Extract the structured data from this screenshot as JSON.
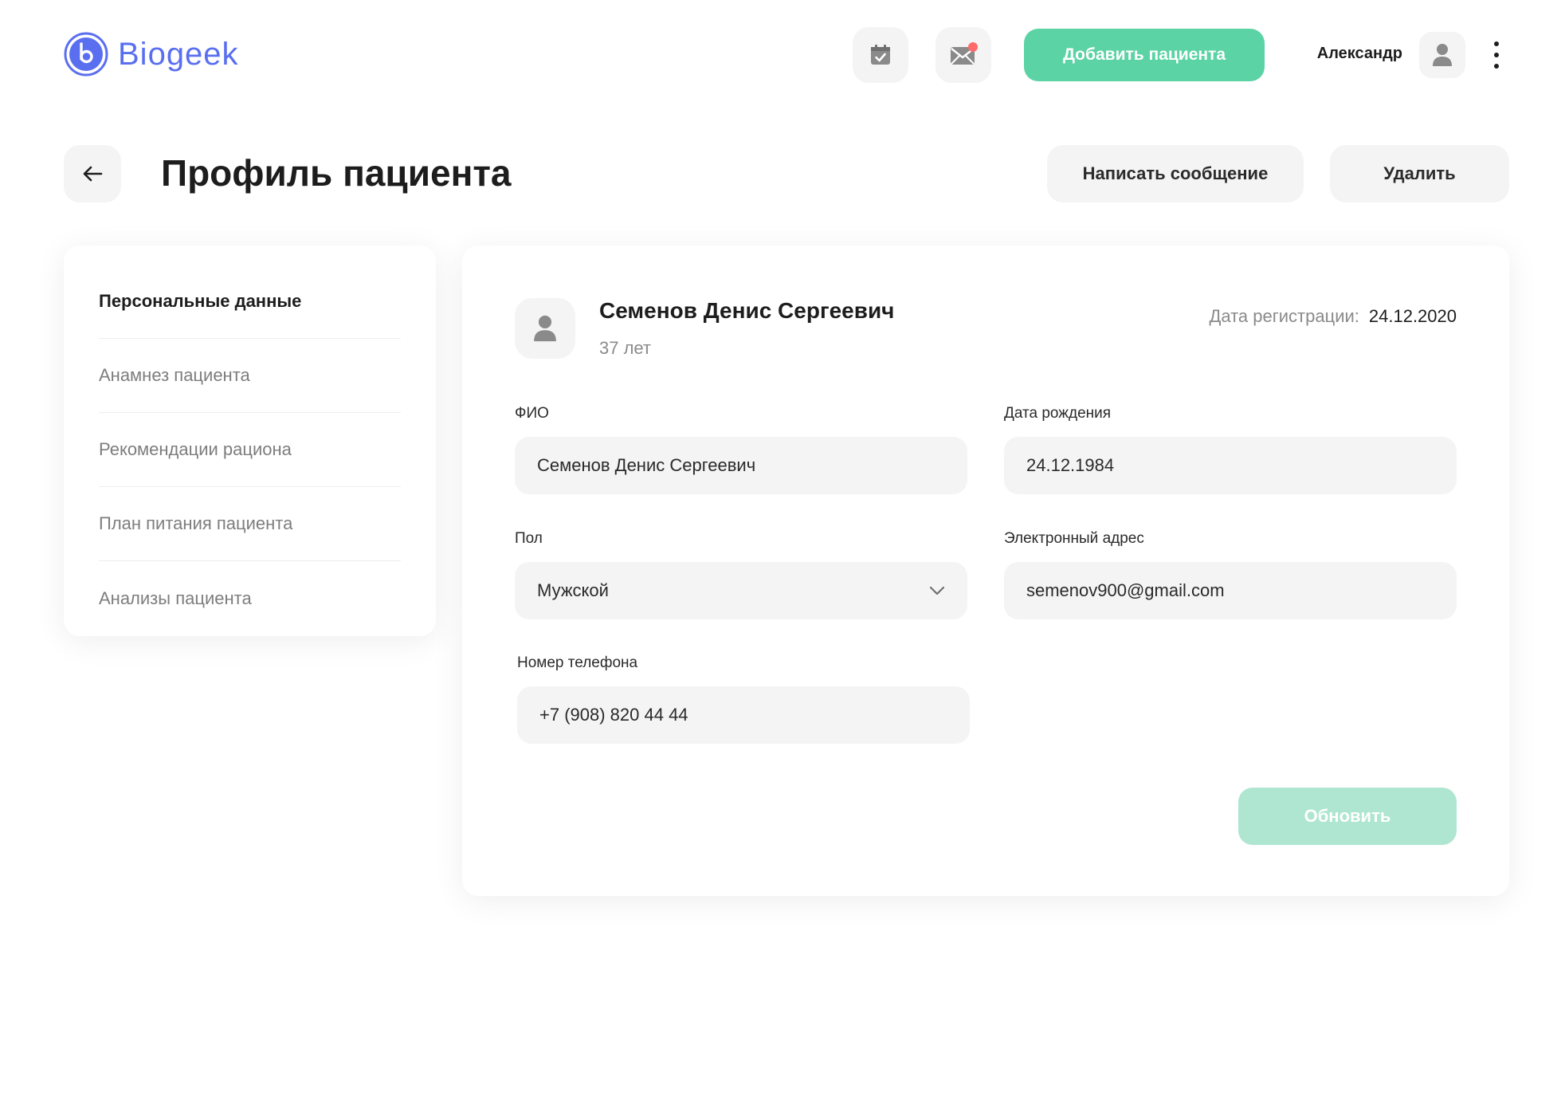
{
  "app": {
    "logo_text": "Biogeek",
    "brand_color": "#5a6ff0",
    "accent_color": "#5bd3a5"
  },
  "header": {
    "calendar_icon": "calendar-check-icon",
    "mail_icon": "mail-icon",
    "notification_dot_color": "#ff6b6b",
    "add_patient_label": "Добавить пациента",
    "user_name": "Александр",
    "user_icon": "user-icon",
    "menu_icon": "kebab-menu-icon"
  },
  "title_row": {
    "back_icon": "arrow-left-icon",
    "title": "Профиль пациента",
    "message_label": "Написать сообщение",
    "delete_label": "Удалить"
  },
  "sidebar": {
    "items": [
      {
        "label": "Персональные данные",
        "active": true
      },
      {
        "label": "Анамнез пациента",
        "active": false
      },
      {
        "label": "Рекомендации рациона",
        "active": false
      },
      {
        "label": "План питания пациента",
        "active": false
      },
      {
        "label": "Анализы пациента",
        "active": false
      }
    ]
  },
  "patient": {
    "name": "Семенов Денис Сергеевич",
    "age": "37 лет",
    "registration_label": "Дата регистрации:",
    "registration_date": "24.12.2020"
  },
  "form": {
    "fio_label": "ФИО",
    "fio_value": "Семенов Денис Сергеевич",
    "birth_label": "Дата рождения",
    "birth_value": "24.12.1984",
    "gender_label": "Пол",
    "gender_value": "Мужской",
    "email_label": "Электронный адрес",
    "email_value": "semenov900@gmail.com",
    "phone_label": "Номер телефона",
    "phone_value": "+7 (908) 820 44 44",
    "update_label": "Обновить"
  }
}
